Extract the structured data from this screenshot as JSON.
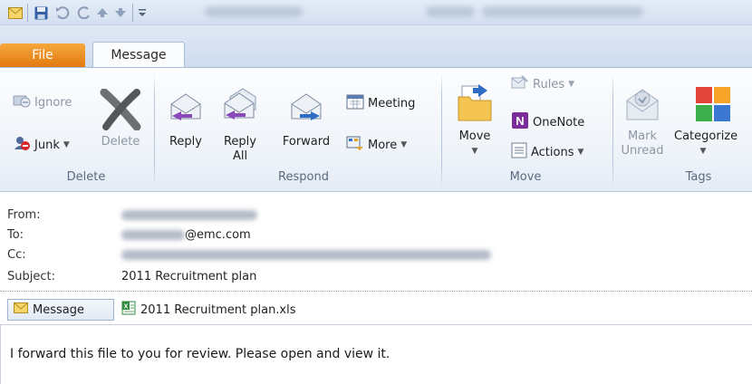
{
  "titlebar": {
    "icons": [
      "mail-icon",
      "save-icon",
      "undo-icon",
      "redo-icon",
      "up-arrow-icon",
      "down-arrow-icon",
      "customize-icon"
    ]
  },
  "tabs": {
    "file": "File",
    "message": "Message"
  },
  "ribbon": {
    "delete_group": {
      "label": "Delete",
      "ignore": "Ignore",
      "junk": "Junk",
      "delete": "Delete"
    },
    "respond_group": {
      "label": "Respond",
      "reply": "Reply",
      "reply_all_1": "Reply",
      "reply_all_2": "All",
      "forward": "Forward",
      "meeting": "Meeting",
      "more": "More"
    },
    "move_group": {
      "label": "Move",
      "move": "Move",
      "rules": "Rules",
      "onenote": "OneNote",
      "actions": "Actions"
    },
    "tags_group": {
      "label": "Tags",
      "mark_unread_1": "Mark",
      "mark_unread_2": "Unread",
      "categorize": "Categorize"
    }
  },
  "header": {
    "from_label": "From:",
    "to_label": "To:",
    "to_value_suffix": "@emc.com",
    "cc_label": "Cc:",
    "subject_label": "Subject:",
    "subject_value": "2011 Recruitment plan"
  },
  "attachments": {
    "message_tab": "Message",
    "file_name": "2011 Recruitment plan.xls"
  },
  "body": {
    "text": "I forward this file to you for review. Please open and view it."
  },
  "colors": {
    "file_tab": "#e27a0f",
    "ribbon_bg": "#eef3f9",
    "accent": "#4a78c2"
  }
}
